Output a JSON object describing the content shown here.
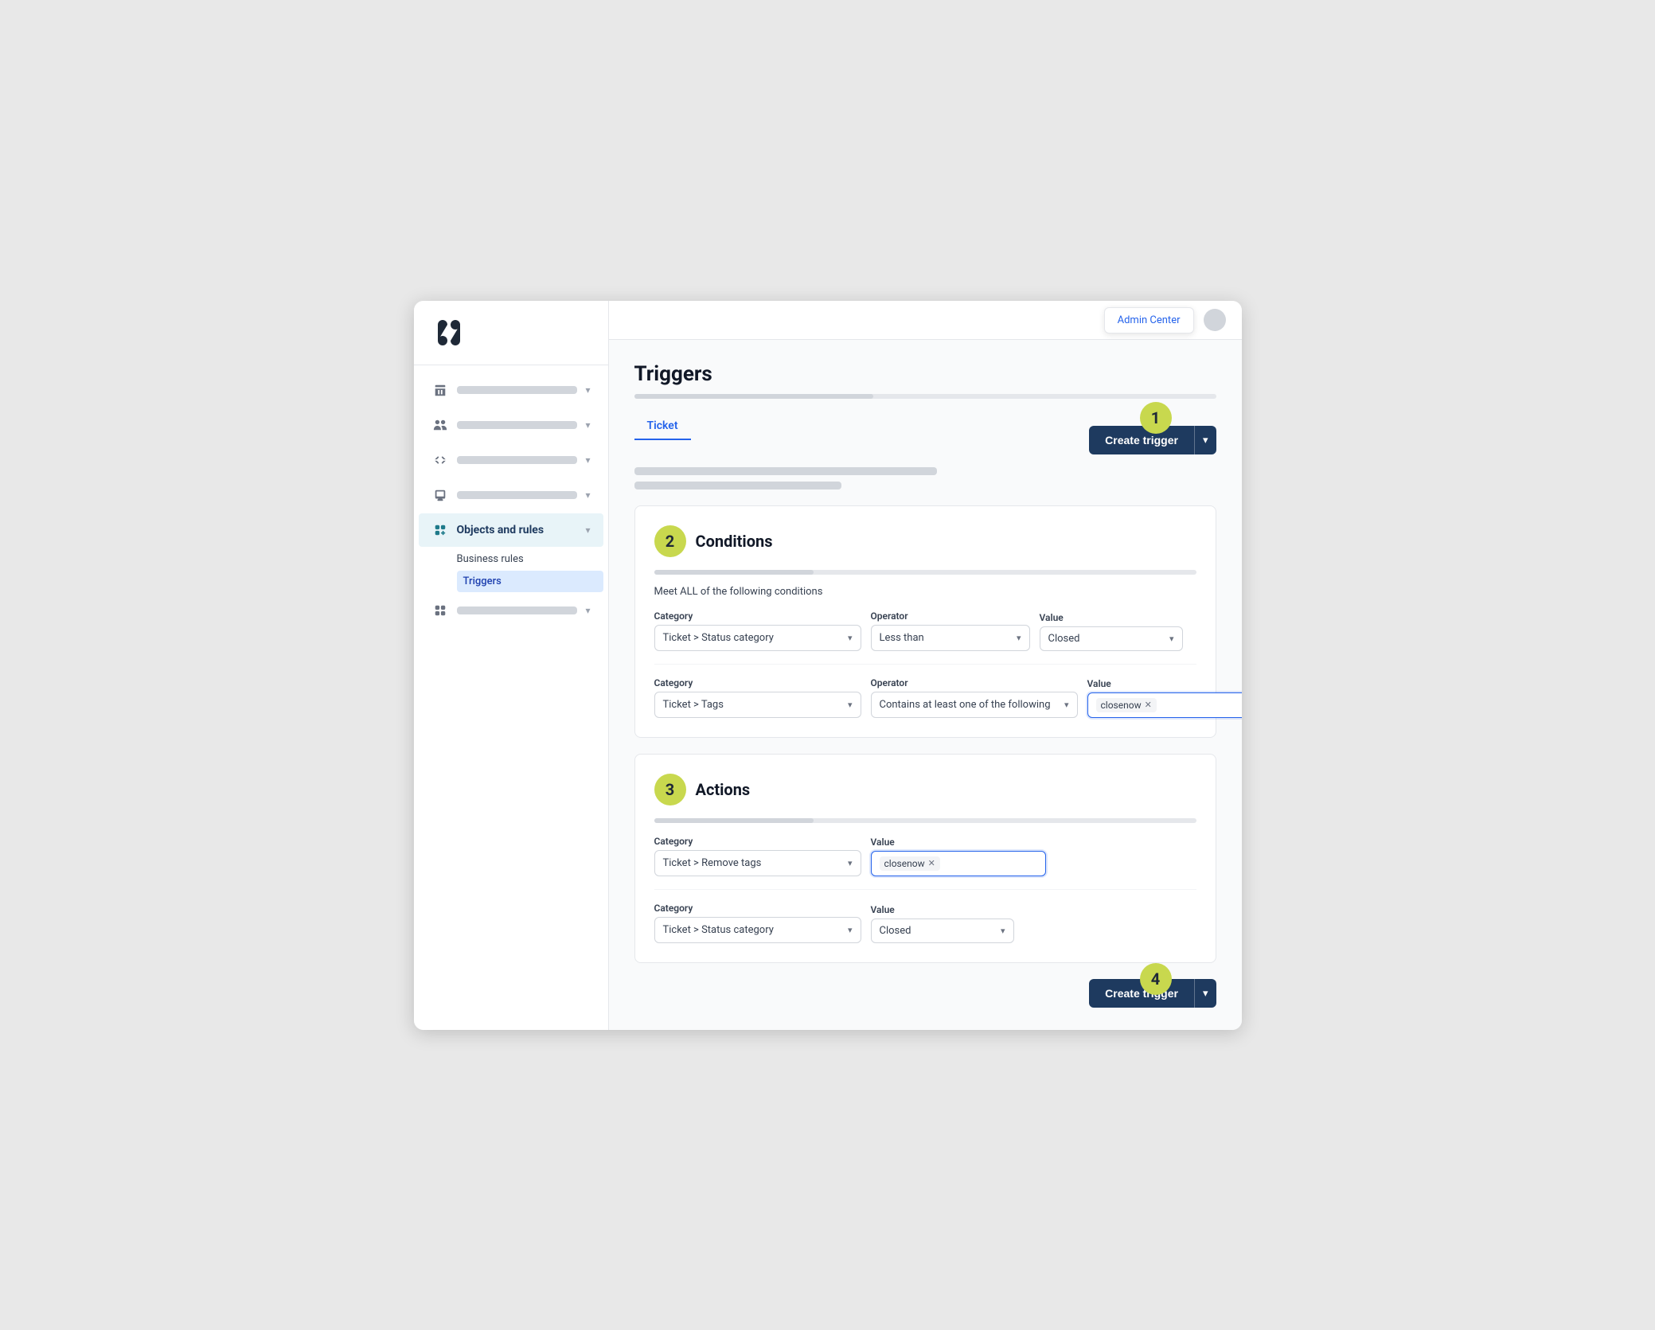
{
  "sidebar": {
    "logo": "✦",
    "nav_items": [
      {
        "id": "buildings",
        "active": false
      },
      {
        "id": "people",
        "active": false
      },
      {
        "id": "arrows",
        "active": false
      },
      {
        "id": "monitor",
        "active": false
      },
      {
        "id": "objects",
        "active": true,
        "label": "Objects and rules"
      },
      {
        "id": "apps",
        "active": false
      }
    ],
    "sub_items": [
      {
        "label": "Business rules",
        "active": false
      },
      {
        "label": "Triggers",
        "active": true
      }
    ]
  },
  "header": {
    "admin_center": "Admin Center",
    "page_title": "Triggers"
  },
  "tabs": [
    {
      "label": "Ticket",
      "active": true
    }
  ],
  "buttons": {
    "create_trigger": "Create trigger"
  },
  "steps": {
    "step1": "1",
    "step2": "2",
    "step3": "3",
    "step4": "4"
  },
  "conditions": {
    "title": "Conditions",
    "subtitle": "Meet ALL of the following conditions",
    "rows": [
      {
        "category_label": "Category",
        "category_value": "Ticket > Status category",
        "operator_label": "Operator",
        "operator_value": "Less than",
        "value_label": "Value",
        "value_value": "Closed"
      },
      {
        "category_label": "Category",
        "category_value": "Ticket > Tags",
        "operator_label": "Operator",
        "operator_value": "Contains at least one of the following",
        "value_label": "Value",
        "value_tag": "closenow"
      }
    ]
  },
  "actions": {
    "title": "Actions",
    "rows": [
      {
        "category_label": "Category",
        "category_value": "Ticket > Remove tags",
        "value_label": "Value",
        "value_tag": "closenow"
      },
      {
        "category_label": "Category",
        "category_value": "Ticket > Status category",
        "value_label": "Value",
        "value_value": "Closed"
      }
    ]
  }
}
